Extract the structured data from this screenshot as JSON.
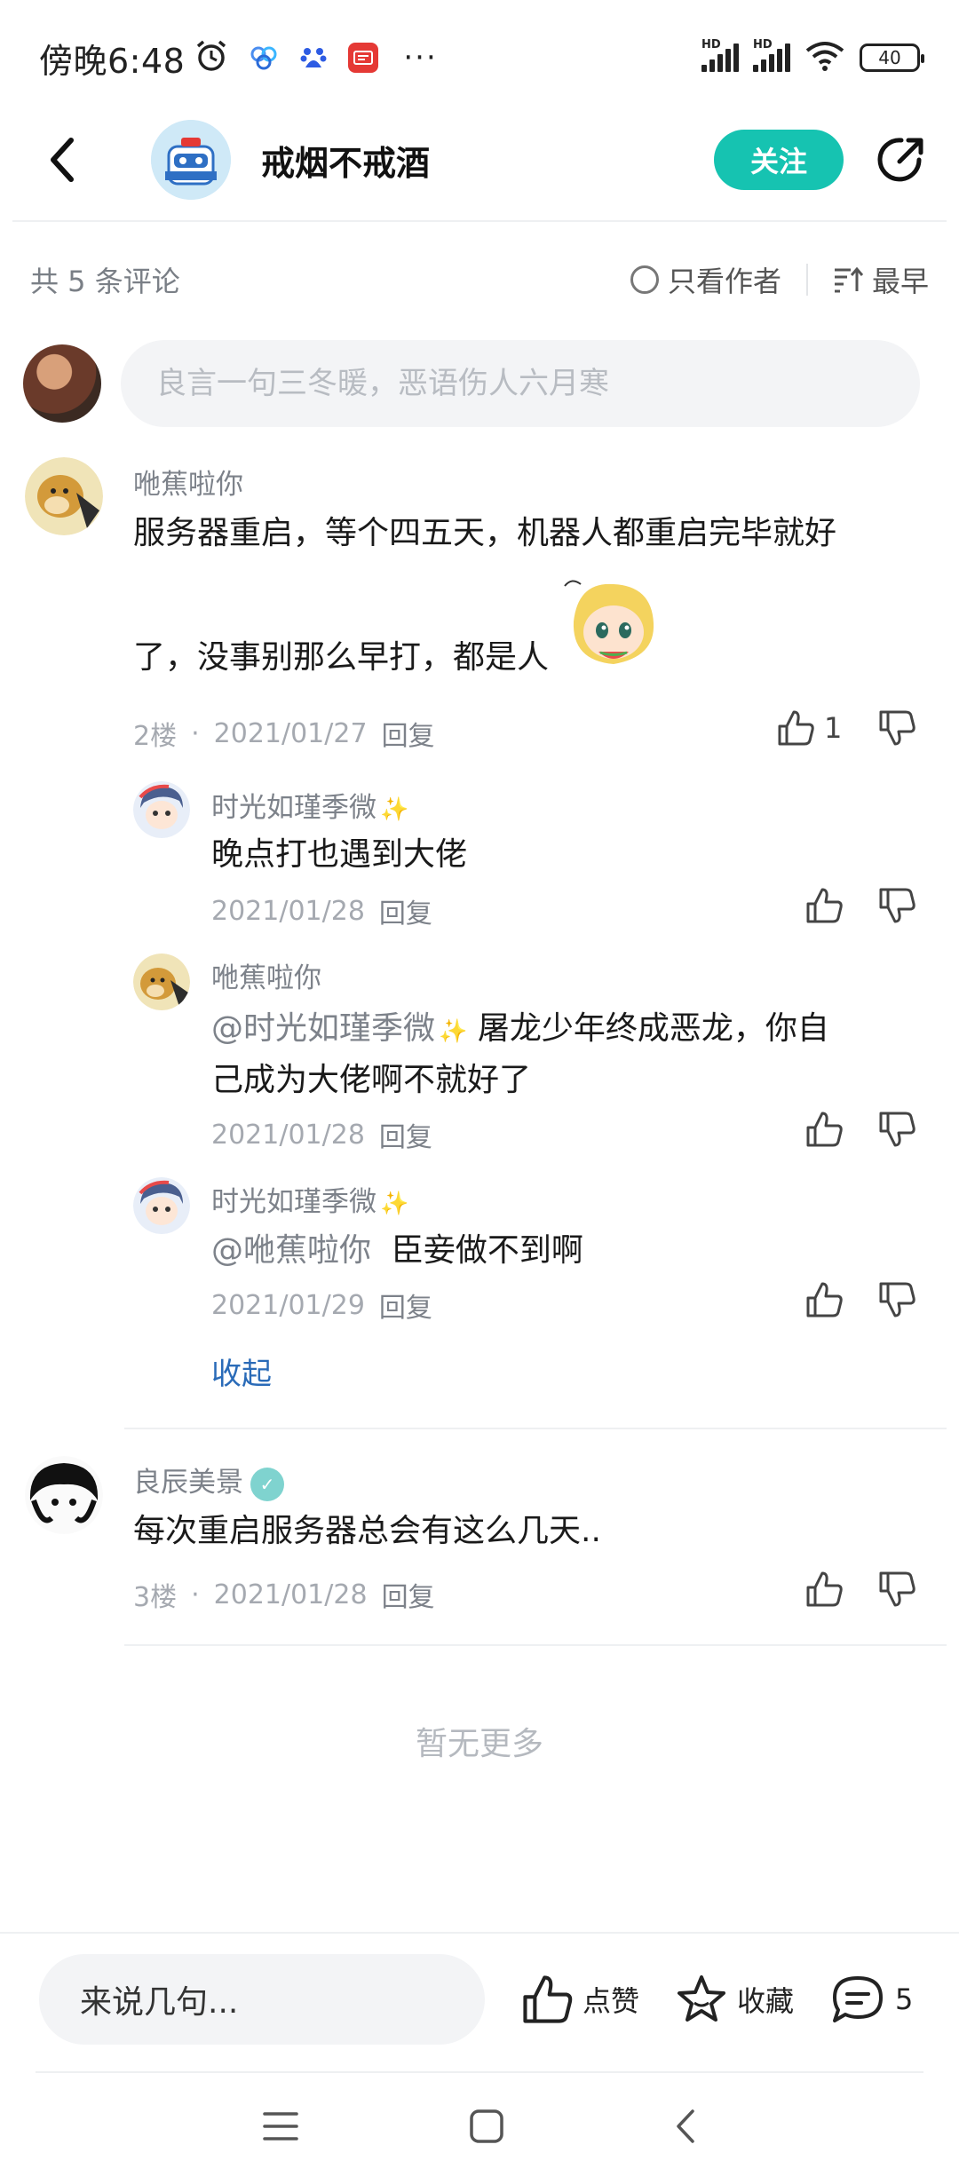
{
  "status_bar": {
    "time": "傍晚6:48",
    "more": "···",
    "battery": "40",
    "hd1": "HD",
    "hd2": "HD"
  },
  "header": {
    "title": "戒烟不戒酒",
    "follow_label": "关注"
  },
  "toolbar": {
    "count_label": "共 5 条评论",
    "author_only_label": "只看作者",
    "sort_label": "最早"
  },
  "input": {
    "placeholder": "良言一句三冬暖，恶语伤人六月寒"
  },
  "comments": [
    {
      "user": "咃蕉啦你",
      "text_line1": "服务器重启，等个四五天，机器人都重启完毕就好",
      "text_line2": "了，没事别那么早打，都是人",
      "floor": "2楼",
      "date": "2021/01/27",
      "reply_label": "回复",
      "likes": "1",
      "replies": [
        {
          "user": "时光如瑾季微",
          "text": "晚点打也遇到大佬",
          "date": "2021/01/28",
          "reply_label": "回复"
        },
        {
          "user": "咃蕉啦你",
          "mention": "@时光如瑾季微",
          "text_line1": "屠龙少年终成恶龙，你自",
          "text_line2": "己成为大佬啊不就好了",
          "date": "2021/01/28",
          "reply_label": "回复"
        },
        {
          "user": "时光如瑾季微",
          "mention": "@咃蕉啦你",
          "text": "臣妾做不到啊",
          "date": "2021/01/29",
          "reply_label": "回复"
        }
      ],
      "collapse_label": "收起"
    },
    {
      "user": "良辰美景",
      "text": "每次重启服务器总会有这么几天..",
      "floor": "3楼",
      "date": "2021/01/28",
      "reply_label": "回复"
    }
  ],
  "no_more": "暂无更多",
  "bottom_bar": {
    "say_placeholder": "来说几句...",
    "like_label": "点赞",
    "fav_label": "收藏",
    "comment_count": "5"
  },
  "colors": {
    "accent": "#16c3b1",
    "link": "#2a6bb8"
  }
}
